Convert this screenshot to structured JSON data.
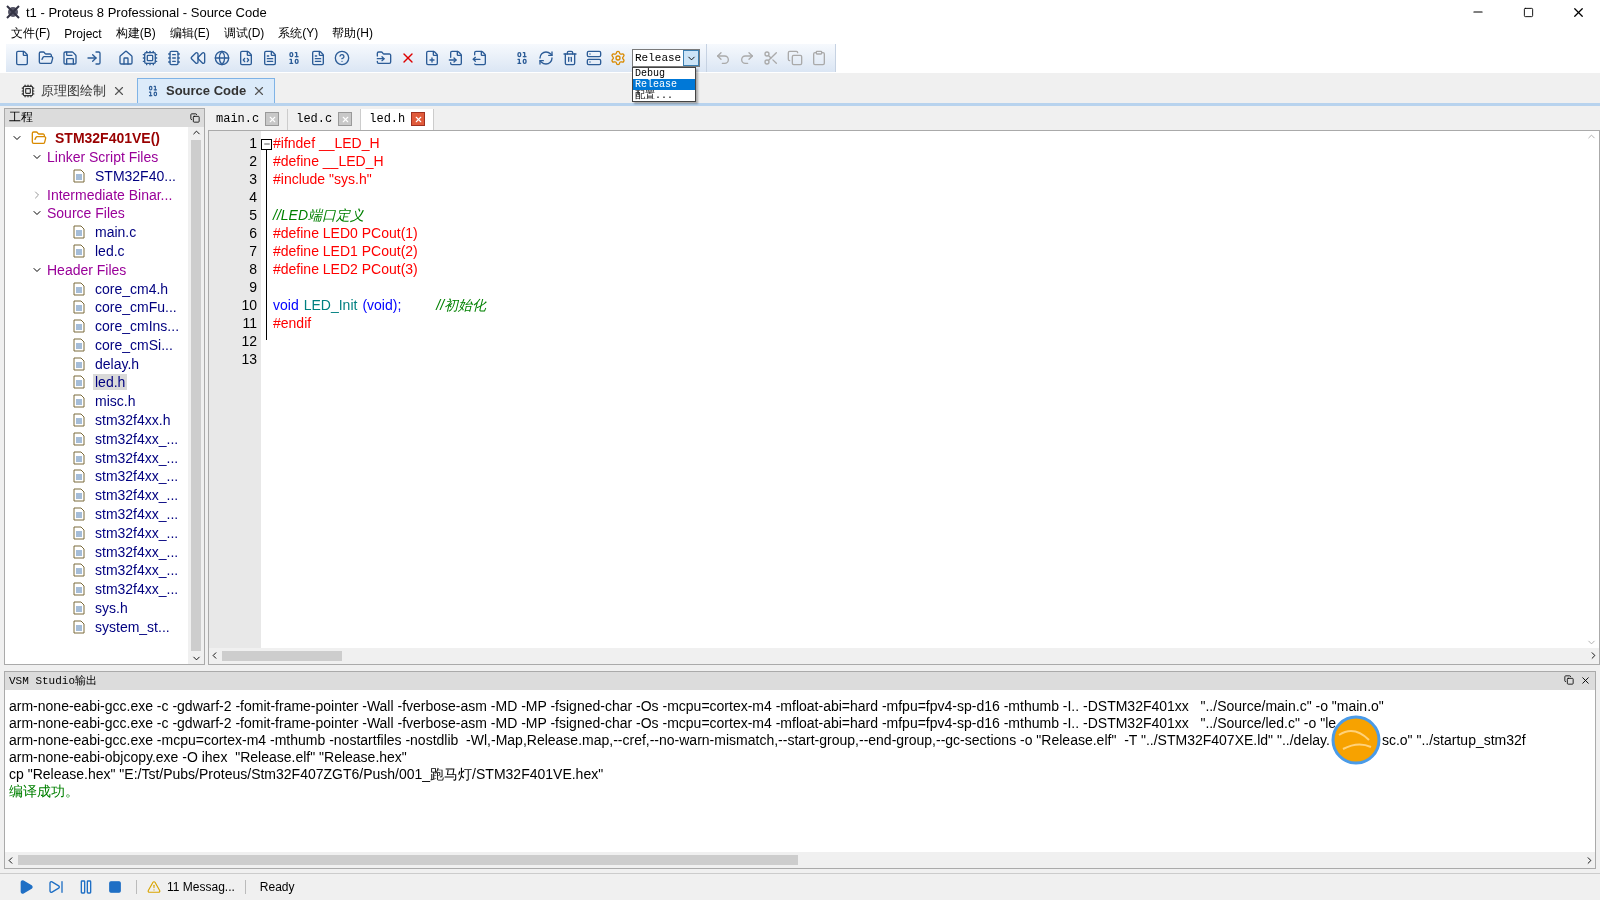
{
  "window": {
    "title": "t1 - Proteus 8 Professional - Source Code"
  },
  "menu": [
    "文件(F)",
    "Project",
    "构建(B)",
    "编辑(E)",
    "调试(D)",
    "系统(Y)",
    "帮助(H)"
  ],
  "build_config": {
    "value": "Release",
    "expanded": true,
    "options": [
      {
        "label": "Debug",
        "selected": false
      },
      {
        "label": "Release",
        "selected": true
      },
      {
        "label": "配置..."
      }
    ]
  },
  "doc_tabs": [
    {
      "label": "原理图绘制",
      "selected": false
    },
    {
      "label": "Source Code",
      "selected": true
    }
  ],
  "project_panel": {
    "title": "工程",
    "tree": [
      {
        "label": "STM32F401VE()",
        "kind": "root",
        "expanded": true,
        "children": [
          {
            "label": "Linker Script Files",
            "kind": "group",
            "expanded": true,
            "children": [
              {
                "label": "STM32F40...",
                "kind": "file",
                "selected": false
              }
            ]
          },
          {
            "label": "Intermediate Binar...",
            "kind": "group",
            "expanded": false
          },
          {
            "label": "Source Files",
            "kind": "group",
            "expanded": true,
            "children": [
              {
                "label": "main.c",
                "kind": "file",
                "selected": false
              },
              {
                "label": "led.c",
                "kind": "file",
                "selected": false
              }
            ]
          },
          {
            "label": "Header Files",
            "kind": "group",
            "expanded": true,
            "children": [
              {
                "label": "core_cm4.h",
                "kind": "file",
                "selected": false
              },
              {
                "label": "core_cmFu...",
                "kind": "file",
                "selected": false
              },
              {
                "label": "core_cmIns...",
                "kind": "file",
                "selected": false
              },
              {
                "label": "core_cmSi...",
                "kind": "file",
                "selected": false
              },
              {
                "label": "delay.h",
                "kind": "file",
                "selected": false
              },
              {
                "label": "led.h",
                "kind": "file",
                "selected": true
              },
              {
                "label": "misc.h",
                "kind": "file",
                "selected": false
              },
              {
                "label": "stm32f4xx.h",
                "kind": "file",
                "selected": false
              },
              {
                "label": "stm32f4xx_...",
                "kind": "file",
                "selected": false
              },
              {
                "label": "stm32f4xx_...",
                "kind": "file",
                "selected": false
              },
              {
                "label": "stm32f4xx_...",
                "kind": "file",
                "selected": false
              },
              {
                "label": "stm32f4xx_...",
                "kind": "file",
                "selected": false
              },
              {
                "label": "stm32f4xx_...",
                "kind": "file",
                "selected": false
              },
              {
                "label": "stm32f4xx_...",
                "kind": "file",
                "selected": false
              },
              {
                "label": "stm32f4xx_...",
                "kind": "file",
                "selected": false
              },
              {
                "label": "stm32f4xx_...",
                "kind": "file",
                "selected": false
              },
              {
                "label": "stm32f4xx_...",
                "kind": "file",
                "selected": false
              },
              {
                "label": "sys.h",
                "kind": "file",
                "selected": false
              },
              {
                "label": "system_st...",
                "kind": "file",
                "selected": false
              }
            ]
          }
        ]
      }
    ]
  },
  "editor_tabs": [
    {
      "label": "main.c",
      "selected": false
    },
    {
      "label": "led.c",
      "selected": false
    },
    {
      "label": "led.h",
      "selected": true
    }
  ],
  "code_lines": [
    {
      "number": "1",
      "tokens": [
        {
          "kind": "pre",
          "text": "#ifndef __LED_H"
        }
      ]
    },
    {
      "number": "2",
      "tokens": [
        {
          "kind": "pre",
          "text": "#define __LED_H"
        }
      ]
    },
    {
      "number": "3",
      "tokens": [
        {
          "kind": "pre",
          "text": "#include \"sys.h\""
        }
      ]
    },
    {
      "number": "4"
    },
    {
      "number": "5",
      "tokens": [
        {
          "kind": "comment",
          "text": "//LED端口定义"
        }
      ]
    },
    {
      "number": "6",
      "tokens": [
        {
          "kind": "pre",
          "text": "#define LED0 PCout(1)"
        }
      ]
    },
    {
      "number": "7",
      "tokens": [
        {
          "kind": "pre",
          "text": "#define LED1 PCout(2)"
        }
      ]
    },
    {
      "number": "8",
      "tokens": [
        {
          "kind": "pre",
          "text": "#define LED2 PCout(3)"
        }
      ]
    },
    {
      "number": "9"
    },
    {
      "number": "10",
      "tokens": [
        {
          "kind": "keyword",
          "text": "void"
        },
        {
          "kind": "ident",
          "text": "LED_Init"
        },
        {
          "kind": "keyword",
          "text": "(void);"
        },
        {
          "kind": "comment",
          "text": "//初始化"
        }
      ]
    },
    {
      "number": "11",
      "tokens": [
        {
          "kind": "pre",
          "text": "#endif"
        }
      ]
    },
    {
      "number": "12"
    },
    {
      "number": "13"
    }
  ],
  "output_panel": {
    "title": "VSM Studio输出",
    "lines": [
      {
        "kind": "plain",
        "segments": [
          "arm-none-eabi-gcc.exe -c -gdwarf-2 -fomit-frame-pointer -Wall -fverbose-asm -MD -MP -fsigned-char -Os -mcpu=cortex-m4 -mfloat-abi=hard -mfpu=fpv4-sp-d16 -mthumb -I.. -DSTM32F401xx   \"../Source/main.c\" -o \"main.o\""
        ]
      },
      {
        "kind": "plain",
        "segments": [
          "arm-none-eabi-gcc.exe -c -gdwarf-2 -fomit-frame-pointer -Wall -fverbose-asm -MD -MP -fsigned-char -Os -mcpu=cortex-m4 -mfloat-abi=hard -mfpu=fpv4-sp-d16 -mthumb -I.. -DSTM32F401xx   \"../Source/led.c\" -o \"le"
        ]
      },
      {
        "kind": "plain",
        "segments": [
          "arm-none-eabi-gcc.exe -mcpu=cortex-m4 -mthumb -nostartfiles -nostdlib  -Wl,-Map,Release.map,--cref,--no-warn-mismatch,--start-group,--end-group,--gc-sections -o \"Release.elf\"  -T \"../STM32F407XE.ld\" \"../delay.",
          "sc.o\" \"../startup_stm32f"
        ]
      },
      {
        "kind": "plain",
        "segments": [
          "arm-none-eabi-objcopy.exe -O ihex  \"Release.elf\" \"Release.hex\""
        ]
      },
      {
        "kind": "plain",
        "segments": [
          "cp \"Release.hex\" \"E:/Tst/Pubs/Proteus/Stm32F407ZGT6/Push/001_跑马灯/STM32F401VE.hex\""
        ]
      },
      {
        "kind": "success",
        "segments": [
          "编译成功。"
        ]
      }
    ]
  },
  "status_bar": {
    "messages": "11 Messag...",
    "status": "Ready"
  }
}
